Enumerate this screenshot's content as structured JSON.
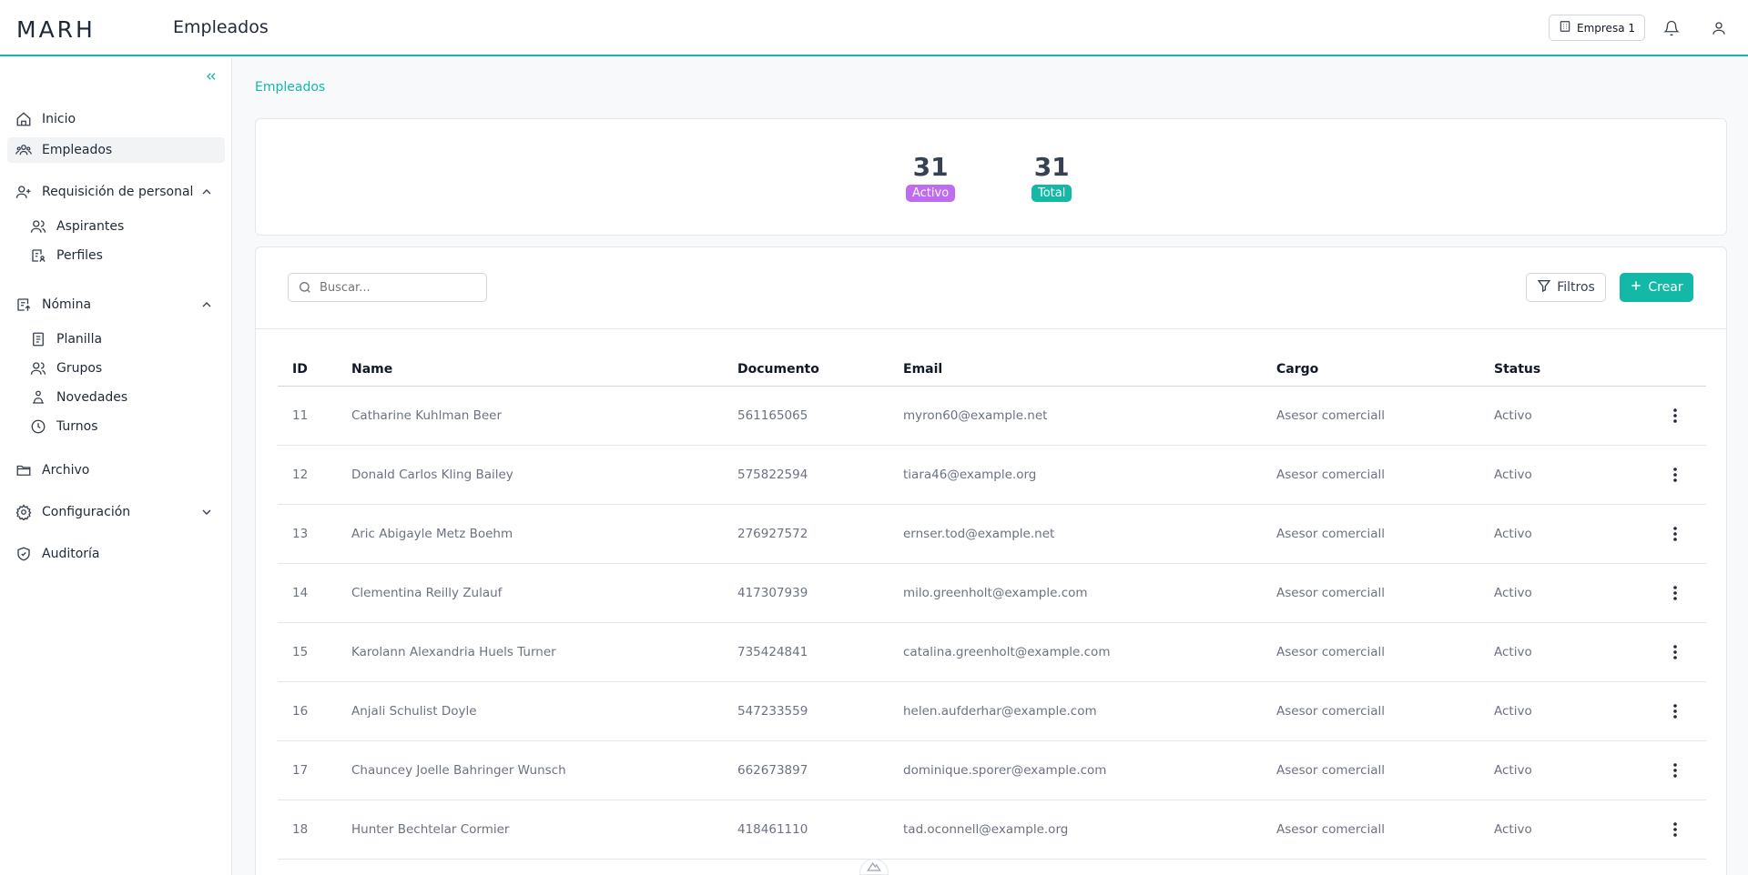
{
  "header": {
    "logo": "MARH",
    "page_title": "Empleados",
    "company_label": "Empresa 1"
  },
  "sidebar": {
    "items": [
      {
        "label": "Inicio",
        "icon": "home-icon"
      },
      {
        "label": "Empleados",
        "icon": "users-icon",
        "active": true
      },
      {
        "label": "Requisición de personal",
        "icon": "user-plus-icon",
        "expanded": true
      },
      {
        "label": "Aspirantes",
        "icon": "users-icon"
      },
      {
        "label": "Perfiles",
        "icon": "profile-list-icon"
      },
      {
        "label": "Nómina",
        "icon": "payroll-icon",
        "expanded": true
      },
      {
        "label": "Planilla",
        "icon": "document-icon"
      },
      {
        "label": "Grupos",
        "icon": "users-icon"
      },
      {
        "label": "Novedades",
        "icon": "person-hand-icon"
      },
      {
        "label": "Turnos",
        "icon": "clock-icon"
      },
      {
        "label": "Archivo",
        "icon": "folder-icon"
      },
      {
        "label": "Configuración",
        "icon": "gear-icon",
        "expanded": false
      },
      {
        "label": "Auditoría",
        "icon": "shield-check-icon"
      }
    ]
  },
  "breadcrumb": "Empleados",
  "stats": {
    "active": {
      "value": "31",
      "label": "Activo",
      "color": "#c06cf0"
    },
    "total": {
      "value": "31",
      "label": "Total",
      "color": "#14b8a6"
    }
  },
  "toolbar": {
    "search_placeholder": "Buscar...",
    "filter_label": "Filtros",
    "create_label": "Crear"
  },
  "table": {
    "columns": [
      "ID",
      "Name",
      "Documento",
      "Email",
      "Cargo",
      "Status"
    ],
    "rows": [
      [
        "11",
        "Catharine Kuhlman Beer",
        "561165065",
        "myron60@example.net",
        "Asesor comerciall",
        "Activo"
      ],
      [
        "12",
        "Donald Carlos Kling Bailey",
        "575822594",
        "tiara46@example.org",
        "Asesor comerciall",
        "Activo"
      ],
      [
        "13",
        "Aric Abigayle Metz Boehm",
        "276927572",
        "ernser.tod@example.net",
        "Asesor comerciall",
        "Activo"
      ],
      [
        "14",
        "Clementina Reilly Zulauf",
        "417307939",
        "milo.greenholt@example.com",
        "Asesor comerciall",
        "Activo"
      ],
      [
        "15",
        "Karolann Alexandria Huels Turner",
        "735424841",
        "catalina.greenholt@example.com",
        "Asesor comerciall",
        "Activo"
      ],
      [
        "16",
        "Anjali Schulist Doyle",
        "547233559",
        "helen.aufderhar@example.com",
        "Asesor comerciall",
        "Activo"
      ],
      [
        "17",
        "Chauncey Joelle Bahringer Wunsch",
        "662673897",
        "dominique.sporer@example.com",
        "Asesor comerciall",
        "Activo"
      ],
      [
        "18",
        "Hunter Bechtelar Cormier",
        "418461110",
        "tad.oconnell@example.org",
        "Asesor comerciall",
        "Activo"
      ]
    ]
  },
  "colors": {
    "accent": "#14b8a6",
    "active_badge": "#c06cf0"
  }
}
